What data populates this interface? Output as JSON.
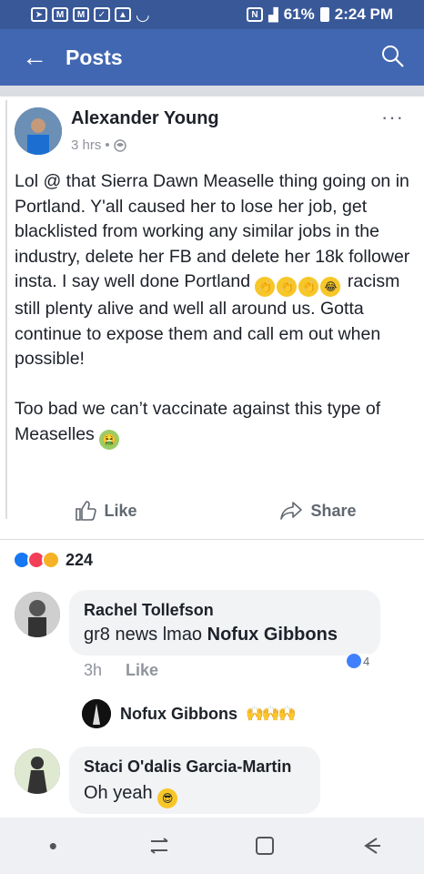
{
  "status_bar": {
    "battery": "61%",
    "time": "2:24 PM",
    "left_icons": [
      "location-icon",
      "mail-icon",
      "mail-icon",
      "checklist-icon",
      "image-icon",
      "wifi-icon"
    ],
    "right_icons": [
      "nfc-icon",
      "signal-icon",
      "battery-icon"
    ]
  },
  "nav": {
    "title": "Posts",
    "back_icon": "arrow-left-icon",
    "search_icon": "search-icon"
  },
  "post": {
    "author": "Alexander Young",
    "time": "3 hrs",
    "privacy_icon": "globe-icon",
    "text_part1": "Lol @ that Sierra Dawn Measelle thing going on in Portland. Y'all caused her to lose her job, get blacklisted from working any similar jobs in the industry, delete her FB and delete her 18k follower insta. I say well done Portland ",
    "text_part2": " racism still plenty alive and well all around us. Gotta continue to expose them and call em out when possible!\n\nToo bad we can’t vaccinate against this type of Measelles ",
    "like_label": "Like",
    "share_label": "Share"
  },
  "reactions": {
    "count": "224",
    "types": [
      "like-icon",
      "love-icon",
      "haha-icon"
    ]
  },
  "comments": [
    {
      "name": "Rachel Tollefson",
      "text": "gr8 news lmao ",
      "mention": "Nofux Gibbons",
      "time": "3h",
      "like_label": "Like",
      "like_count": "4"
    },
    {
      "reply_name": "Nofux Gibbons"
    },
    {
      "name": "Staci O'dalis Garcia-Martin",
      "text": "Oh yeah "
    }
  ],
  "colors": {
    "status_bar": "#385898",
    "nav_bar": "#4267b2",
    "text": "#1d2129",
    "muted": "#90949c"
  }
}
